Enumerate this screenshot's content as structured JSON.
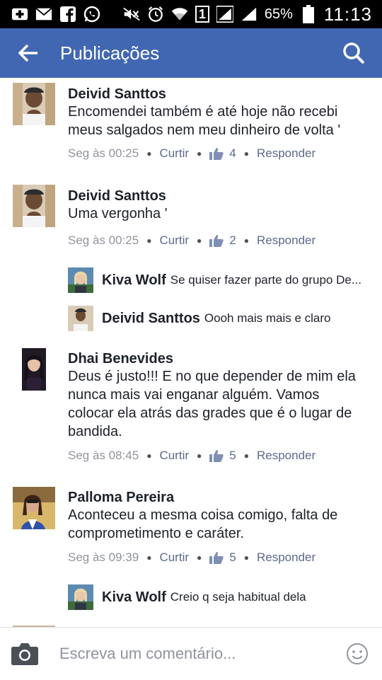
{
  "status_bar": {
    "left_icons": [
      "add-box-icon",
      "mail-icon",
      "facebook-icon",
      "whatsapp-icon"
    ],
    "right_icons": [
      "mute-icon",
      "alarm-icon",
      "wifi-icon",
      "sim-icon",
      "signal-icon",
      "signal-icon"
    ],
    "sim_label": "1",
    "battery": "65%",
    "time": "11:13"
  },
  "app_bar": {
    "title": "Publicações"
  },
  "comments": [
    {
      "name": "Deivid Santtos",
      "text": "Encomendei também é até hoje não recebi meus salgados nem meu dinheiro de volta '",
      "time": "Seg às 00:25",
      "like_label": "Curtir",
      "likes": "4",
      "reply_label": "Responder"
    },
    {
      "name": "Deivid Santtos",
      "text": "Uma vergonha '",
      "time": "Seg às 00:25",
      "like_label": "Curtir",
      "likes": "2",
      "reply_label": "Responder"
    },
    {
      "name": "Dhai Benevides",
      "text": "Deus é justo!!! E no que depender de mim ela nunca mais vai  enganar alguém. Vamos colocar ela atrás das grades que é o lugar de bandida.",
      "time": "Seg às 08:45",
      "like_label": "Curtir",
      "likes": "5",
      "reply_label": "Responder"
    },
    {
      "name": "Palloma Pereira",
      "text": "Aconteceu a mesma coisa comigo,  falta de comprometimento e caráter.",
      "time": "Seg às 09:39",
      "like_label": "Curtir",
      "likes": "5",
      "reply_label": "Responder"
    }
  ],
  "replies": [
    {
      "name": "Kiva Wolf",
      "text": "Se quiser fazer parte do grupo De..."
    },
    {
      "name": "Deivid Santtos",
      "text": "Oooh mais mais e claro"
    },
    {
      "name": "Kiva Wolf",
      "text": "Creio q seja habitual dela"
    }
  ],
  "composer": {
    "placeholder": "Escreva um comentário..."
  },
  "colors": {
    "app_bar": "#4267b2",
    "link": "#5b6a8c",
    "meta": "#90949c",
    "text": "#1d2129"
  }
}
